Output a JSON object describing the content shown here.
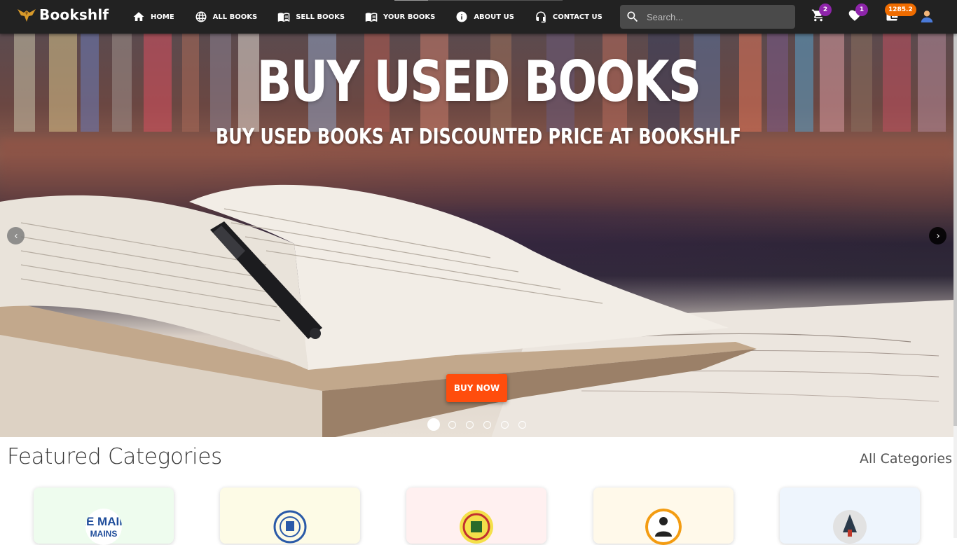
{
  "brand": {
    "name": "Bookshlf"
  },
  "nav": {
    "items": [
      {
        "label": "HOME",
        "icon": "home-icon"
      },
      {
        "label": "ALL BOOKS",
        "icon": "globe-icon"
      },
      {
        "label": "SELL BOOKS",
        "icon": "book-open-icon"
      },
      {
        "label": "YOUR BOOKS",
        "icon": "book-open-icon"
      },
      {
        "label": "ABOUT US",
        "icon": "info-icon"
      },
      {
        "label": "CONTACT US",
        "icon": "headset-icon"
      }
    ]
  },
  "search": {
    "placeholder": "Search..."
  },
  "badges": {
    "cart": "2",
    "wishlist": "1",
    "wallet": "1285.2"
  },
  "colors": {
    "navbar": "#222222",
    "accent": "#ff4d0d",
    "badge_purple": "#8e24aa",
    "badge_orange": "#ef6c00"
  },
  "hero": {
    "title": "BUY USED BOOKS",
    "subtitle": "BUY USED BOOKS AT DISCOUNTED PRICE AT BOOKSHLF",
    "button": "BUY NOW",
    "slide_count": 6,
    "active_slide": 1
  },
  "featured": {
    "title": "Featured Categories",
    "all_link": "All Categories",
    "categories": [
      {
        "logo_text": "JEE MAINS",
        "bg": "#eefcee"
      },
      {
        "logo_text": "",
        "bg": "#fdfbe6"
      },
      {
        "logo_text": "",
        "bg": "#fff0f0"
      },
      {
        "logo_text": "",
        "bg": "#fff9ea"
      },
      {
        "logo_text": "",
        "bg": "#eef5fd"
      }
    ]
  }
}
